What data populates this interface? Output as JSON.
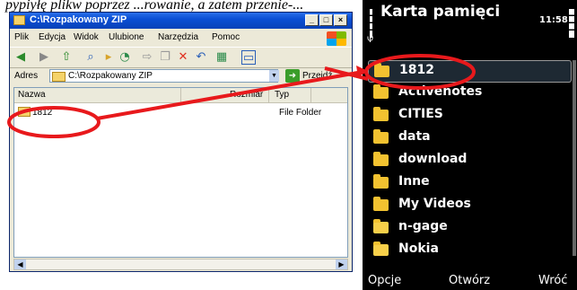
{
  "caption": "pypiyłę  plikw poprzez ...rowanie, a zatem przenie-...",
  "explorer": {
    "title": "C:\\Rozpakowany ZIP",
    "window_buttons": [
      "_",
      "□",
      "×"
    ],
    "menu": [
      "Plik",
      "Edycja",
      "Widok",
      "Ulubione",
      "Narzędzia",
      "Pomoc"
    ],
    "address_label": "Adres",
    "address_value": "C:\\Rozpakowany ZIP",
    "go_label": "Przejdź",
    "columns": [
      "Nazwa",
      "Rozmiar",
      "Typ"
    ],
    "rows": [
      {
        "name": "1812",
        "size": "",
        "type": "File Folder"
      }
    ],
    "toolbar_icons": [
      "back-icon",
      "forward-icon",
      "up-folder-icon",
      "search-icon",
      "folders-icon",
      "history-icon",
      "move-icon",
      "copy-icon",
      "delete-icon",
      "undo-icon",
      "views-icon"
    ]
  },
  "phone": {
    "title": "Karta pamięci",
    "time": "11:58",
    "folders": [
      {
        "name": "1812",
        "selected": true
      },
      {
        "name": "Activenotes",
        "selected": false
      },
      {
        "name": "CITIES",
        "selected": false
      },
      {
        "name": "data",
        "selected": false
      },
      {
        "name": "download",
        "selected": false
      },
      {
        "name": "Inne",
        "selected": false
      },
      {
        "name": "My Videos",
        "selected": false
      },
      {
        "name": "n-gage",
        "selected": false
      },
      {
        "name": "Nokia",
        "selected": false
      }
    ],
    "softkeys": {
      "left": "Opcje",
      "middle": "Otwórz",
      "right": "Wróć"
    }
  },
  "colors": {
    "annotation": "#e8191c",
    "xp_title": "#0a4fd4",
    "folder": "#f2c230",
    "selection": "#1e2933"
  }
}
